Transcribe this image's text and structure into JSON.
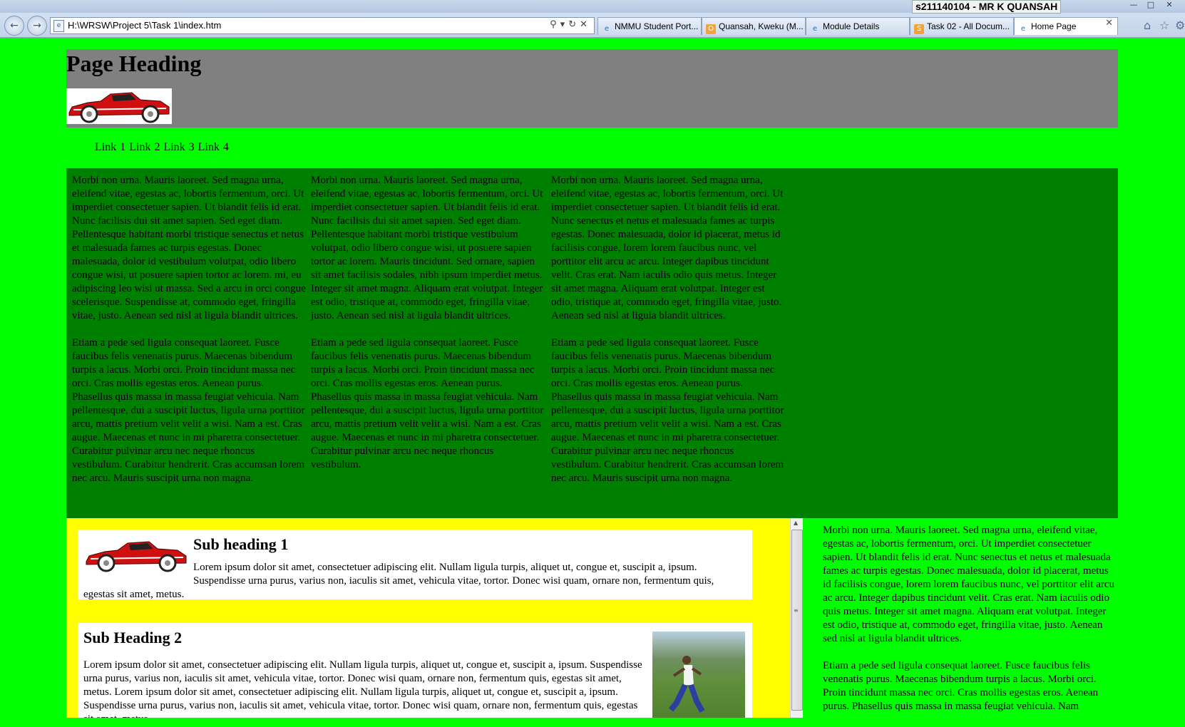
{
  "browser": {
    "user_badge": "s211140104 - MR K QUANSAH",
    "address": "H:\\WRSW\\Project 5\\Task 1\\index.htm",
    "tabs": [
      {
        "label": "NMMU Student Port..."
      },
      {
        "label": "Quansah, Kweku (M..."
      },
      {
        "label": "Module Details"
      },
      {
        "label": "Task 02 - All Docum..."
      },
      {
        "label": "Home Page"
      }
    ]
  },
  "page": {
    "heading": "Page Heading",
    "nav": [
      "Link 1",
      "Link 2",
      "Link 3",
      "Link 4"
    ],
    "columns": [
      {
        "p1": "Morbi non urna. Mauris laoreet. Sed magna urna, eleifend vitae, egestas ac, lobortis fermentum, orci. Ut imperdiet consectetuer sapien. Ut blandit felis id erat. Nunc facilisis dui sit amet sapien. Sed eget diam. Pellentesque habitant morbi tristique senectus et netus et malesuada fames ac turpis egestas. Donec malesuada, dolor id vestibulum volutpat, odio libero congue wisi, ut posuere sapien tortor ac lorem. mi, eu adipiscing leo wisi ut massa. Sed a arcu in orci congue scelerisque. Suspendisse at, commodo eget, fringilla vitae, justo. Aenean sed nisl at ligula blandit ultrices.",
        "p2": "Etiam a pede sed ligula consequat laoreet. Fusce faucibus felis venenatis purus. Maecenas bibendum turpis a lacus. Morbi orci. Proin tincidunt massa nec orci. Cras mollis egestas eros. Aenean purus. Phasellus quis massa in massa feugiat vehicula. Nam pellentesque, dui a suscipit luctus, ligula urna porttitor arcu, mattis pretium velit velit a wisi. Nam a est. Cras augue. Maecenas et nunc in mi pharetra consectetuer. Curabitur pulvinar arcu nec neque rhoncus vestibulum. Curabitur hendrerit. Cras accumsan lorem nec arcu. Mauris suscipit urna non magna."
      },
      {
        "p1": "Morbi non urna. Mauris laoreet. Sed magna urna, eleifend vitae, egestas ac, lobortis fermentum, orci. Ut imperdiet consectetuer sapien. Ut blandit felis id erat. Nunc facilisis dui sit amet sapien. Sed eget diam. Pellentesque habitant morbi tristique vestibulum volutpat, odio libero congue wisi, ut posuere sapien tortor ac lorem. Mauris tincidunt. Sed ornare, sapien sit amet facilisis sodales, nibh ipsum imperdiet metus. Integer sit amet magna. Aliquam erat volutpat. Integer est odio, tristique at, commodo eget, fringilla vitae, justo. Aenean sed nisl at ligula blandit ultrices.",
        "p2": "Etiam a pede sed ligula consequat laoreet. Fusce faucibus felis venenatis purus. Maecenas bibendum turpis a lacus. Morbi orci. Proin tincidunt massa nec orci. Cras mollis egestas eros. Aenean purus. Phasellus quis massa in massa feugiat vehicula. Nam pellentesque, dui a suscipit luctus, ligula urna porttitor arcu, mattis pretium velit velit a wisi. Nam a est. Cras augue. Maecenas et nunc in mi pharetra consectetuer. Curabitur pulvinar arcu nec neque rhoncus vestibulum."
      },
      {
        "p1": "Morbi non urna. Mauris laoreet. Sed magna urna, eleifend vitae, egestas ac, lobortis fermentum, orci. Ut imperdiet consectetuer sapien. Ut blandit felis id erat. Nunc senectus et netus et malesuada fames ac turpis egestas. Donec malesuada, dolor id placerat, metus id facilisis congue, lorem lorem faucibus nunc, vel porttitor elit arcu ac arcu. Integer dapibus tincidunt velit. Cras erat. Nam iaculis odio quis metus. Integer sit amet magna. Aliquam erat volutpat. Integer est odio, tristique at, commodo eget, fringilla vitae, justo. Aenean sed nisl at ligula blandit ultrices.",
        "p2": "Etiam a pede sed ligula consequat laoreet. Fusce faucibus felis venenatis purus. Maecenas bibendum turpis a lacus. Morbi orci. Proin tincidunt massa nec orci. Cras mollis egestas eros. Aenean purus. Phasellus quis massa in massa feugiat vehicula. Nam pellentesque, dui a suscipit luctus, ligula urna porttitor arcu, mattis pretium velit velit a wisi. Nam a est. Cras augue. Maecenas et nunc in mi pharetra consectetuer. Curabitur pulvinar arcu nec neque rhoncus vestibulum. Curabitur hendrerit. Cras accumsan lorem nec arcu. Mauris suscipit urna non magna."
      }
    ],
    "box1": {
      "heading": "Sub heading 1",
      "text": "Lorem ipsum dolor sit amet, consectetuer adipiscing elit. Nullam ligula turpis, aliquet ut, congue et, suscipit a, ipsum. Suspendisse urna purus, varius non, iaculis sit amet, vehicula vitae, tortor. Donec wisi quam, ornare non, fermentum quis, egestas sit amet, metus."
    },
    "box2": {
      "heading": "Sub Heading 2",
      "text": "Lorem ipsum dolor sit amet, consectetuer adipiscing elit. Nullam ligula turpis, aliquet ut, congue et, suscipit a, ipsum. Suspendisse urna purus, varius non, iaculis sit amet, vehicula vitae, tortor. Donec wisi quam, ornare non, fermentum quis, egestas sit amet, metus. Lorem ipsum dolor sit amet, consectetuer adipiscing elit. Nullam ligula turpis, aliquet ut, congue et, suscipit a, ipsum. Suspendisse urna purus, varius non, iaculis sit amet, vehicula vitae, tortor. Donec wisi quam, ornare non, fermentum quis, egestas sit amet, metus."
    },
    "sidebar": {
      "p1": "Morbi non urna. Mauris laoreet. Sed magna urna, eleifend vitae, egestas ac, lobortis fermentum, orci. Ut imperdiet consectetuer sapien. Ut blandit felis id erat. Nunc senectus et netus et malesuada fames ac turpis egestas. Donec malesuada, dolor id placerat, metus id facilisis congue, lorem lorem faucibus nunc, vel porttitor elit arcu ac arcu. Integer dapibus tincidunt velit. Cras erat. Nam iaculis odio quis metus. Integer sit amet magna. Aliquam erat volutpat. Integer est odio, tristique at, commodo eget, fringilla vitae, justo. Aenean sed nisl at ligula blandit ultrices.",
      "p2": "Etiam a pede sed ligula consequat laoreet. Fusce faucibus felis venenatis purus. Maecenas bibendum turpis a lacus. Morbi orci. Proin tincidunt massa nec orci. Cras mollis egestas eros. Aenean purus. Phasellus quis massa in massa feugiat vehicula. Nam"
    }
  },
  "colors": {
    "page_bg": "#00ff00",
    "header_bg": "#808080",
    "main_bg": "#008000",
    "lower_bg": "#ffff00",
    "box_bg": "#ffffff"
  }
}
